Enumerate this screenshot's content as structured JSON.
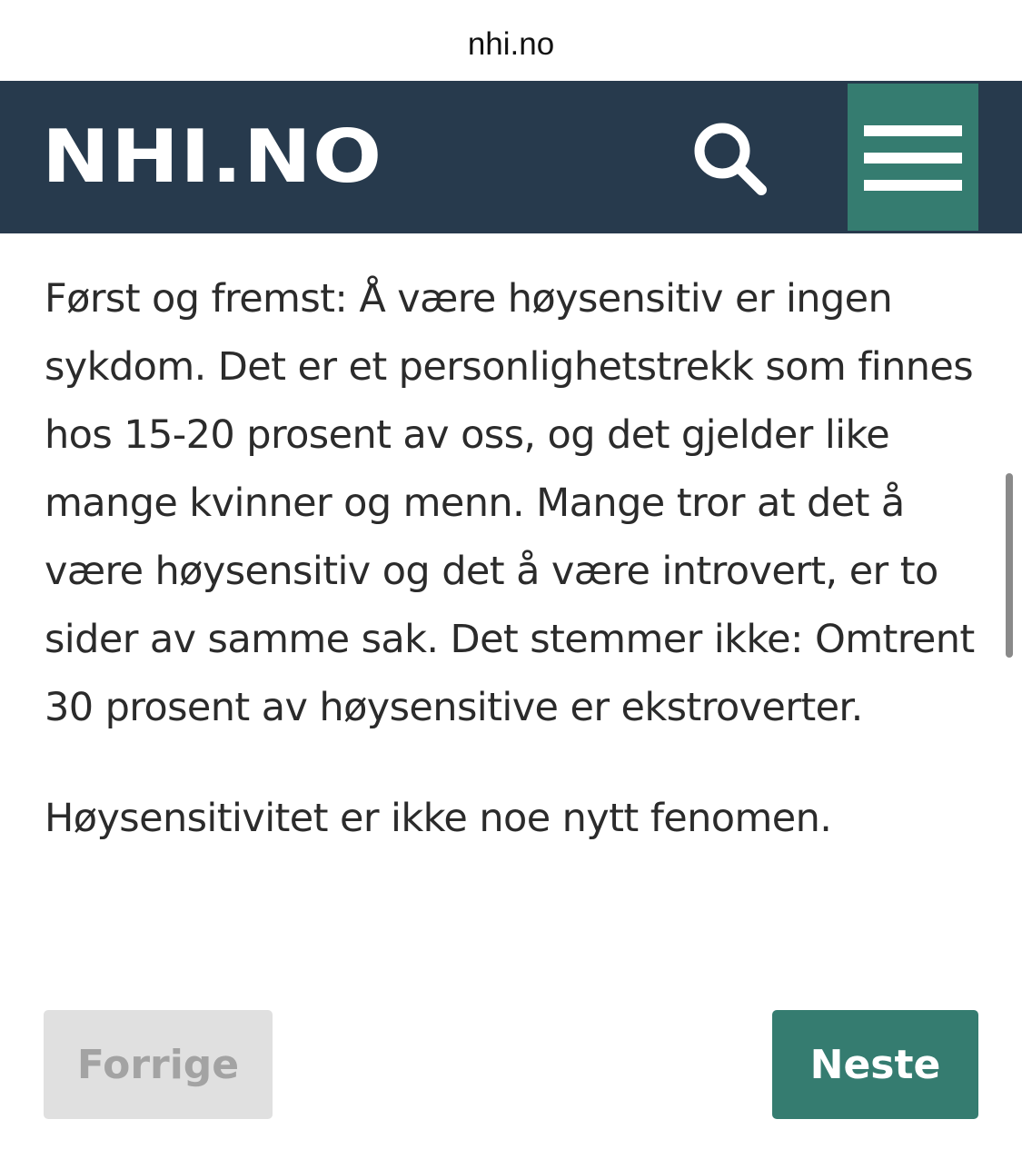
{
  "browser": {
    "url": "nhi.no"
  },
  "header": {
    "logo_text": "NHI.NO",
    "search_icon": "search-icon",
    "menu_icon": "hamburger-menu-icon",
    "background_color": "#273a4d",
    "menu_button_color": "#357c70"
  },
  "article": {
    "paragraphs": [
      "Først og fremst: Å være høysensitiv er ingen sykdom. Det er et personlighetstrekk som finnes hos 15-20 prosent av oss, og det gjelder like mange kvinner og menn. Mange tror at det å være høysensitiv og det å være introvert, er to sider av samme sak. Det stemmer ikke: Omtrent 30 prosent av høysensitive er ekstroverter.",
      "Høysensitivitet er ikke noe nytt fenomen."
    ]
  },
  "pagination": {
    "previous_label": "Forrige",
    "next_label": "Neste",
    "previous_enabled": false,
    "next_color": "#357c70"
  }
}
